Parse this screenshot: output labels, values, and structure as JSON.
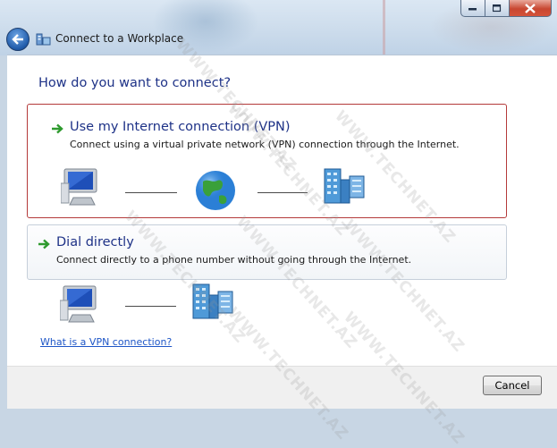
{
  "window": {
    "title": "Connect to a Workplace",
    "controls": {
      "minimize_icon": "minimize-icon",
      "maximize_icon": "maximize-icon",
      "close_icon": "close-icon"
    }
  },
  "navigation": {
    "back_icon": "back-arrow-icon"
  },
  "main": {
    "heading": "How do you want to connect?",
    "options": [
      {
        "title": "Use my Internet connection (VPN)",
        "description": "Connect using a virtual private network (VPN) connection through the Internet.",
        "selected": true,
        "diagram": [
          "computer-icon",
          "globe-icon",
          "workplace-building-icon"
        ]
      },
      {
        "title": "Dial directly",
        "description": "Connect directly to a phone number without going through the Internet.",
        "selected": false,
        "diagram": [
          "computer-icon",
          "workplace-building-icon"
        ]
      }
    ],
    "help_link": "What is a VPN connection?"
  },
  "footer": {
    "cancel_label": "Cancel"
  },
  "watermark": {
    "text": "WWW.TECHNET.AZ"
  },
  "colors": {
    "heading_blue": "#1e3287",
    "link_blue": "#1e56c7",
    "selection_border": "#b43a3a",
    "arrow_green": "#2e9a2e"
  }
}
